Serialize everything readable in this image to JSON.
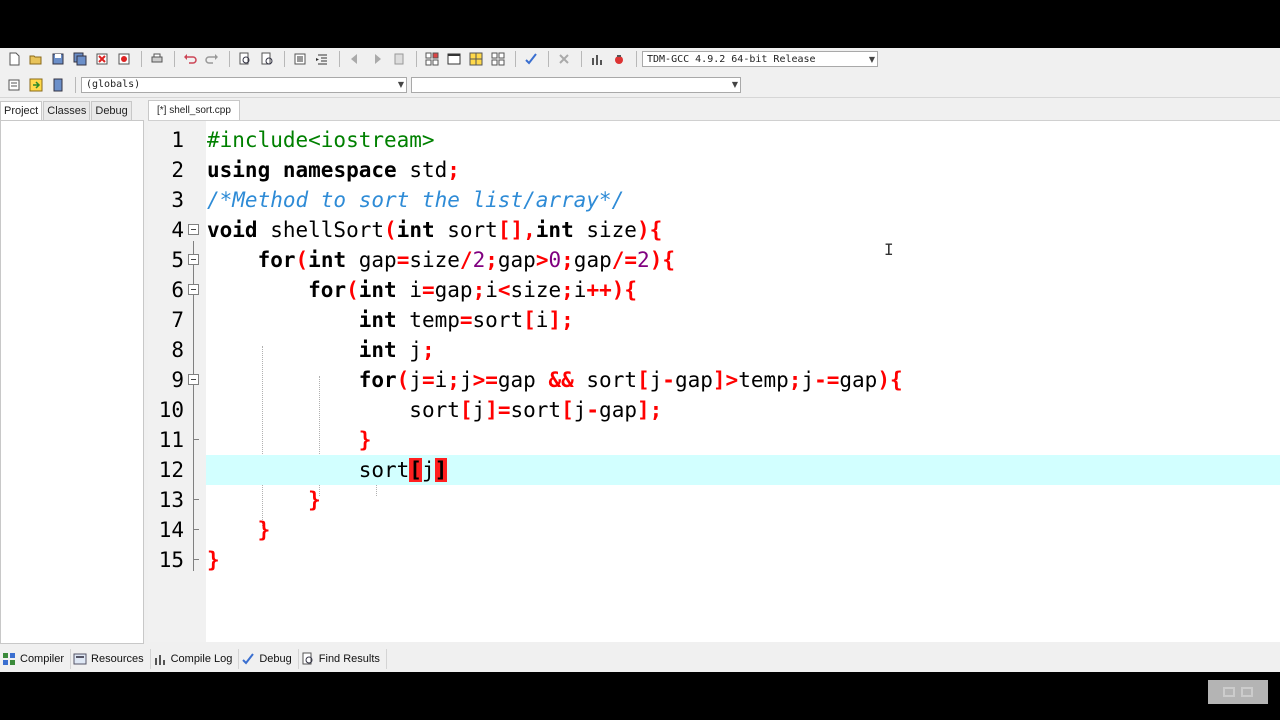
{
  "toolbar": {
    "compiler_select": "TDM-GCC 4.9.2 64-bit Release",
    "scope_select": "(globals)",
    "member_select": ""
  },
  "left_tabs": [
    "Project",
    "Classes",
    "Debug"
  ],
  "editor_tab": "[*] shell_sort.cpp",
  "line_numbers": [
    "1",
    "2",
    "3",
    "4",
    "5",
    "6",
    "7",
    "8",
    "9",
    "10",
    "11",
    "12",
    "13",
    "14",
    "15"
  ],
  "code": {
    "l1": "#include<iostream>",
    "l2_kw1": "using",
    "l2_kw2": "namespace",
    "l2_rest": " std",
    "l2_semi": ";",
    "l3": "/*Method to sort the list/array*/",
    "l4_void": "void",
    "l4_name": " shellSort",
    "l4_int1": "int",
    "l4_a": " sort",
    "l4_int2": "int",
    "l4_b": " size",
    "l5_for": "for",
    "l5_int": "int",
    "l5_a": " gap",
    "l5_b": "size",
    "l5_n1": "2",
    "l5_c": "gap",
    "l5_n2": "0",
    "l5_d": "gap",
    "l5_n3": "2",
    "l6_for": "for",
    "l6_int": "int",
    "l6_a": " i",
    "l6_b": "gap",
    "l6_c": "i",
    "l6_d": "size",
    "l6_e": "i",
    "l7_int": "int",
    "l7_a": " temp",
    "l7_b": "sort",
    "l7_c": "i",
    "l8_int": "int",
    "l8_a": " j",
    "l9_for": "for",
    "l9_a": "j",
    "l9_b": "i",
    "l9_c": "j",
    "l9_d": "gap ",
    "l9_e": " sort",
    "l9_f": "j",
    "l9_g": "gap",
    "l9_h": "temp",
    "l9_i": "j",
    "l9_j": "gap",
    "l10_a": "sort",
    "l10_b": "j",
    "l10_c": "sort",
    "l10_d": "j",
    "l10_e": "gap",
    "l12_a": "sort",
    "l12_b": "j"
  },
  "bottom_tabs": [
    "Compiler",
    "Resources",
    "Compile Log",
    "Debug",
    "Find Results"
  ],
  "icons": [
    "new-file-icon",
    "open-icon",
    "save-icon",
    "save-all-icon",
    "close-icon",
    "close-all-icon",
    "print-icon",
    "undo-icon",
    "redo-icon",
    "find-icon",
    "replace-icon",
    "indent-icon",
    "unindent-icon",
    "back-icon",
    "forward-icon",
    "goto-icon",
    "new-project-icon",
    "window-icon",
    "grid-icon",
    "toggle-icon",
    "check-icon",
    "stop-icon",
    "chart-icon",
    "debug-icon"
  ]
}
